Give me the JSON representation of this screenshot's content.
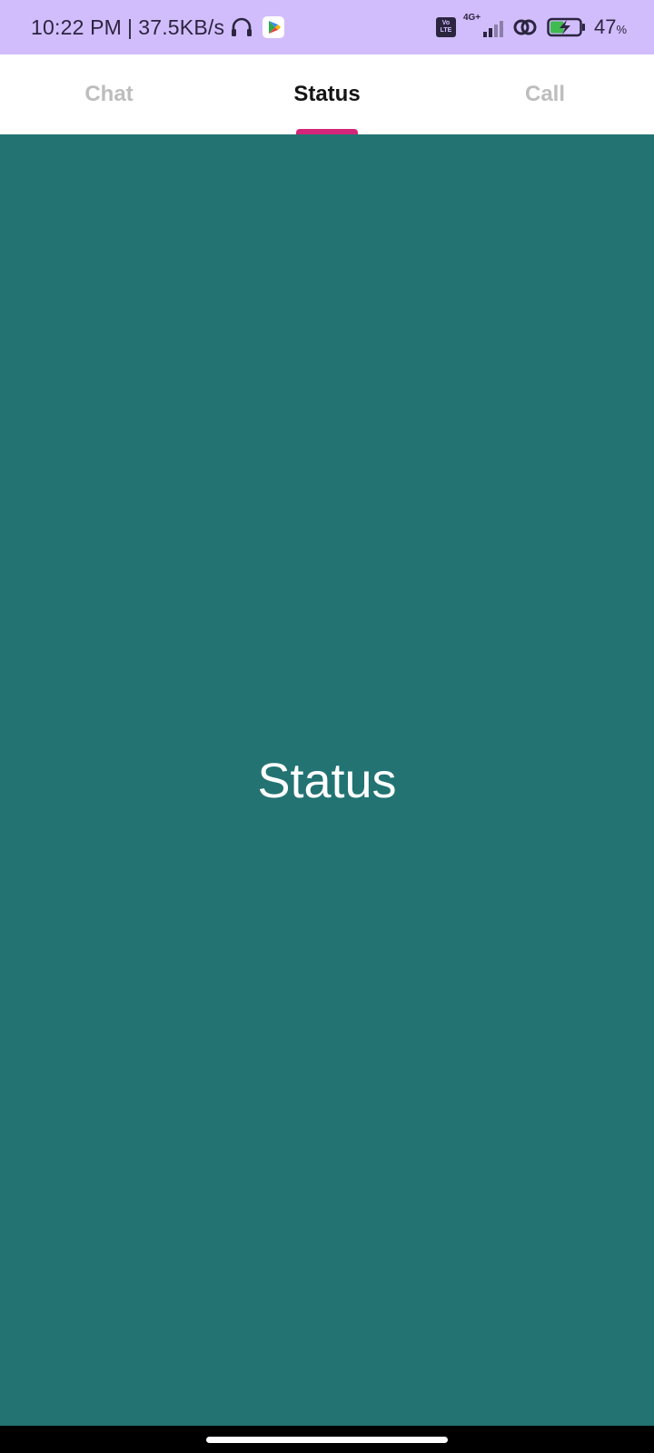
{
  "status_bar": {
    "time": "10:22 PM",
    "separator": "|",
    "net_speed": "37.5KB/s",
    "network": "4G+",
    "volte_top": "Vo",
    "volte_bottom": "LTE",
    "battery_percent": "47",
    "battery_unit": "%",
    "battery_level": 0.47,
    "icons": [
      "headphones-icon",
      "play-store-icon",
      "volte-icon",
      "signal-icon",
      "hotspot-link-icon",
      "battery-charging-icon"
    ]
  },
  "tabs": [
    {
      "label": "Chat",
      "active": false
    },
    {
      "label": "Status",
      "active": true
    },
    {
      "label": "Call",
      "active": false
    }
  ],
  "content": {
    "title": "Status"
  },
  "colors": {
    "status_bar_bg": "#d2bdfc",
    "content_bg": "#237373",
    "tab_indicator": "#d3267a",
    "active_tab_text": "#141414",
    "inactive_tab_text": "#bdbdbd"
  }
}
